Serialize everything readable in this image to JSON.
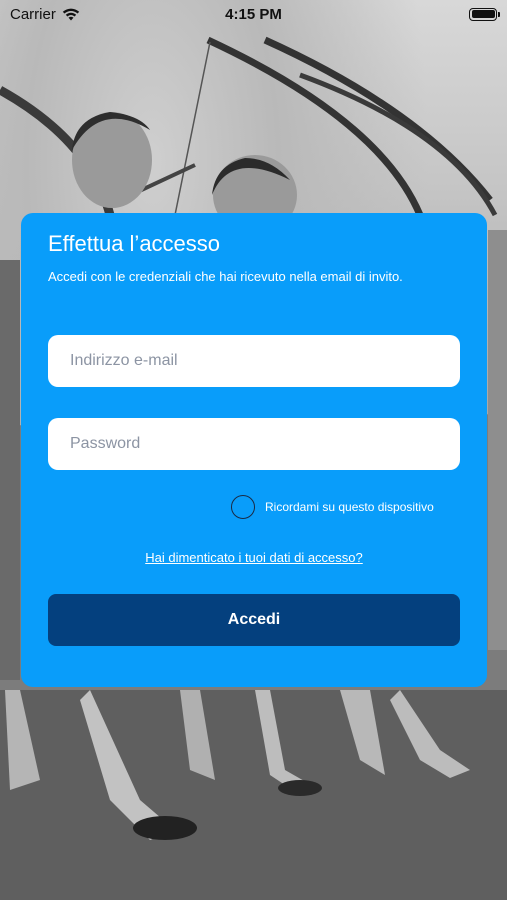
{
  "status_bar": {
    "carrier": "Carrier",
    "time": "4:15 PM",
    "wifi_icon": "wifi-icon",
    "battery_icon": "battery-icon",
    "battery_level": 1.0
  },
  "login": {
    "title": "Effettua l’accesso",
    "subtitle": "Accedi con le credenziali che hai ricevuto nella email di invito.",
    "email_placeholder": "Indirizzo e-mail",
    "email_value": "",
    "password_placeholder": "Password",
    "password_value": "",
    "remember_label": "Ricordami su questo dispositivo",
    "remember_checked": false,
    "forgot_link": "Hai dimenticato i tuoi dati di accesso?",
    "submit_label": "Accedi"
  },
  "colors": {
    "card_background": "#099dfa",
    "submit_background": "#04407e",
    "text_on_card": "#ffffff"
  }
}
